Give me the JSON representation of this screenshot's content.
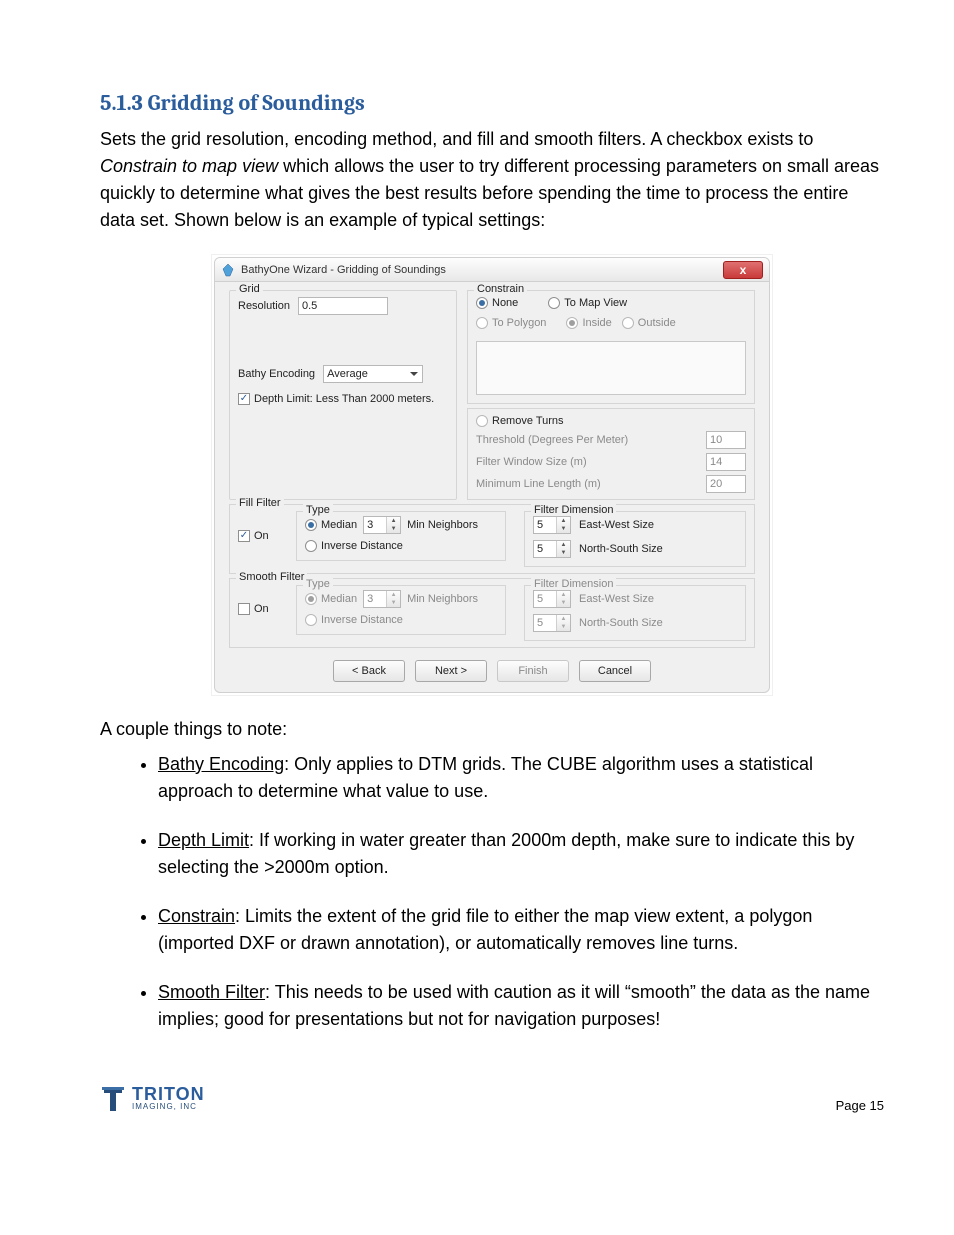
{
  "heading": "5.1.3 Gridding of Soundings",
  "intro_a": "Sets the grid resolution, encoding method, and fill and smooth filters.  A checkbox exists to ",
  "intro_em": "Constrain to map view",
  "intro_b": " which allows the user to try different processing parameters on small areas quickly to determine what gives the best results before spending the time to process the entire data set. Shown below is an example of typical settings:",
  "wizard": {
    "title": "BathyOne Wizard - Gridding of Soundings",
    "close": "x",
    "grid": {
      "legend": "Grid",
      "resolution_label": "Resolution",
      "resolution_value": "0.5",
      "bathy_encoding_label": "Bathy Encoding",
      "bathy_encoding_value": "Average",
      "depth_limit_checked": true,
      "depth_limit_label": "Depth Limit: Less Than 2000 meters."
    },
    "constrain": {
      "legend": "Constrain",
      "none": "None",
      "to_map_view": "To Map View",
      "to_polygon": "To Polygon",
      "inside": "Inside",
      "outside": "Outside",
      "remove_turns": "Remove Turns",
      "threshold_label": "Threshold (Degrees Per Meter)",
      "threshold_value": "10",
      "filter_window_label": "Filter Window Size (m)",
      "filter_window_value": "14",
      "min_line_label": "Minimum Line Length (m)",
      "min_line_value": "20"
    },
    "fill": {
      "legend": "Fill Filter",
      "on": "On",
      "on_checked": true,
      "type_legend": "Type",
      "median": "Median",
      "median_value": "3",
      "min_neighbors": "Min Neighbors",
      "inverse": "Inverse Distance",
      "dim_legend": "Filter Dimension",
      "ew_value": "5",
      "ew_label": "East-West Size",
      "ns_value": "5",
      "ns_label": "North-South Size"
    },
    "smooth": {
      "legend": "Smooth Filter",
      "on": "On",
      "on_checked": false,
      "type_legend": "Type",
      "median": "Median",
      "median_value": "3",
      "min_neighbors": "Min Neighbors",
      "inverse": "Inverse Distance",
      "dim_legend": "Filter Dimension",
      "ew_value": "5",
      "ew_label": "East-West Size",
      "ns_value": "5",
      "ns_label": "North-South Size"
    },
    "buttons": {
      "back": "< Back",
      "next": "Next >",
      "finish": "Finish",
      "cancel": "Cancel"
    }
  },
  "notes_intro": "A couple things to note:",
  "notes": [
    {
      "term": "Bathy Encoding",
      "text": ":  Only applies to DTM grids.  The CUBE algorithm uses a statistical approach to determine what value to use."
    },
    {
      "term": "Depth Limit",
      "text": ":  If working in water greater than 2000m depth, make sure to indicate this by selecting the >2000m option."
    },
    {
      "term": "Constrain",
      "text": ":  Limits the extent of the grid file to either the map view extent, a polygon (imported DXF or drawn annotation), or automatically removes line turns."
    },
    {
      "term": "Smooth Filter",
      "text": ":  This needs to be used with caution as it will “smooth” the data as the name implies; good for presentations but not for navigation purposes!"
    }
  ],
  "logo": {
    "brand": "TRITON",
    "sub": "IMAGING, INC"
  },
  "page_num": "Page 15"
}
